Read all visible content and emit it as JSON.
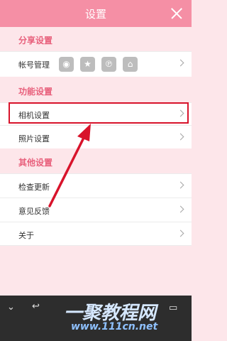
{
  "header": {
    "title": "设置",
    "close_icon": "close-icon"
  },
  "sections": {
    "share": {
      "title": "分享设置",
      "account_row": {
        "label": "帐号管理",
        "icons": [
          "weibo-icon",
          "star-icon",
          "tencent-icon",
          "renren-icon"
        ],
        "icon_glyphs": [
          "◉",
          "★",
          "℗",
          "⌂"
        ]
      }
    },
    "function": {
      "title": "功能设置",
      "rows": [
        {
          "label": "相机设置",
          "highlighted": true
        },
        {
          "label": "照片设置",
          "highlighted": false
        }
      ]
    },
    "other": {
      "title": "其他设置",
      "rows": [
        {
          "label": "检查更新"
        },
        {
          "label": "意见反馈"
        },
        {
          "label": "关于"
        }
      ]
    }
  },
  "watermark": {
    "main": "一聚教程网",
    "sub": "www.111cn.net"
  },
  "colors": {
    "header": "#f58fa5",
    "section_title": "#e8607c",
    "highlight_border": "#d8132b",
    "arrow": "#d8132b"
  }
}
